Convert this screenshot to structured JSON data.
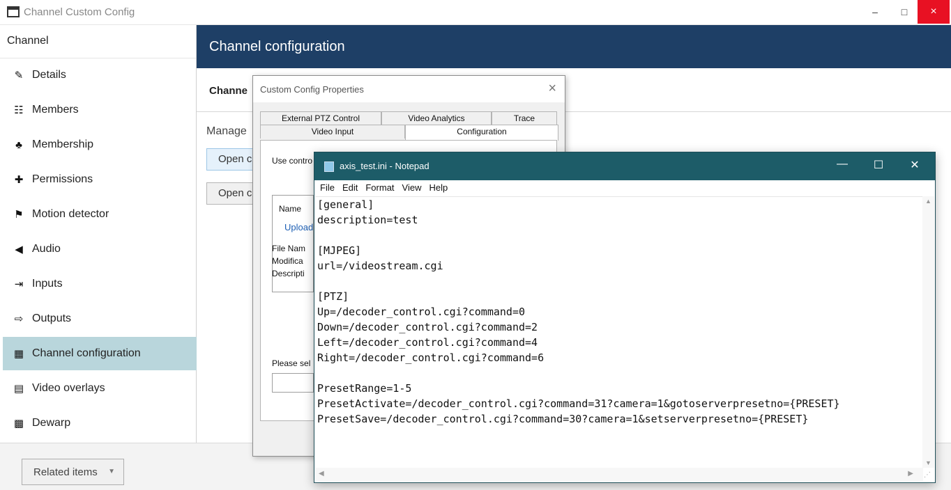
{
  "window": {
    "title": "Channel Custom Config",
    "min_glyph": "–",
    "max_glyph": "□",
    "close_glyph": "×",
    "icon": "window-app-icon"
  },
  "sidebar": {
    "header": "Channel",
    "items": [
      {
        "label": "Details",
        "icon": "pencil-icon",
        "glyph": "✎"
      },
      {
        "label": "Members",
        "icon": "members-icon",
        "glyph": "☷"
      },
      {
        "label": "Membership",
        "icon": "membership-icon",
        "glyph": "♣"
      },
      {
        "label": "Permissions",
        "icon": "permissions-icon",
        "glyph": "✚"
      },
      {
        "label": "Motion detector",
        "icon": "motion-icon",
        "glyph": "⚑"
      },
      {
        "label": "Audio",
        "icon": "speaker-icon",
        "glyph": "◀"
      },
      {
        "label": "Inputs",
        "icon": "input-arrow-icon",
        "glyph": "⇥"
      },
      {
        "label": "Outputs",
        "icon": "output-arrow-icon",
        "glyph": "⇨"
      },
      {
        "label": "Channel configuration",
        "icon": "channel-config-icon",
        "glyph": "▦"
      },
      {
        "label": "Video overlays",
        "icon": "video-overlay-icon",
        "glyph": "▤"
      },
      {
        "label": "Dewarp",
        "icon": "dewarp-icon",
        "glyph": "▩"
      }
    ],
    "active_index": 8
  },
  "main": {
    "header": "Channel configuration",
    "sub": "Channe",
    "manage": "Manage",
    "btn1": "Open c",
    "btn2": "Open c"
  },
  "footer": {
    "related": "Related items"
  },
  "dialog": {
    "title": "Custom Config Properties",
    "close": "×",
    "tabs_back": [
      "External PTZ Control",
      "Video Analytics",
      "Trace"
    ],
    "tabs_front": [
      "Video Input",
      "Configuration"
    ],
    "use_controls": "Use contro",
    "name_label": "Name",
    "upload_link": "Upload",
    "file_name": "File Nam",
    "modified": "Modifica",
    "description": "Descripti",
    "please_select": "Please sel"
  },
  "notepad": {
    "title": "axis_test.ini - Notepad",
    "min": "—",
    "max": "☐",
    "close": "✕",
    "menu": [
      "File",
      "Edit",
      "Format",
      "View",
      "Help"
    ],
    "lines": [
      "[general]",
      "description=test",
      "",
      "[MJPEG]",
      "url=/videostream.cgi",
      "",
      "[PTZ]",
      "Up=/decoder_control.cgi?command=0",
      "Down=/decoder_control.cgi?command=2",
      "Left=/decoder_control.cgi?command=4",
      "Right=/decoder_control.cgi?command=6",
      "",
      "PresetRange=1-5",
      "PresetActivate=/decoder_control.cgi?command=31?camera=1&gotoserverpresetno={PRESET}",
      "PresetSave=/decoder_control.cgi?command=30?camera=1&setserverpresetno={PRESET}"
    ]
  }
}
